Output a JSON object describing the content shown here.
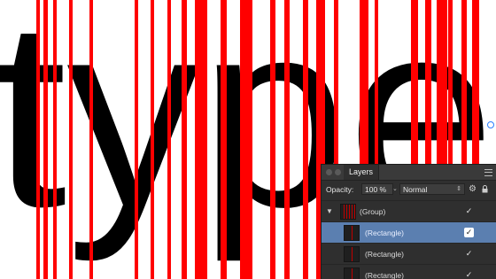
{
  "canvas": {
    "text": "type",
    "text_color": "#000000",
    "stripe_color": "#ff0000"
  },
  "layers_panel": {
    "tab_label": "Layers",
    "opacity_label": "Opacity:",
    "opacity_value": "100 %",
    "blend_mode": "Normal",
    "rows": [
      {
        "name": "(Group)",
        "visible_mark": "✓",
        "selected": false
      },
      {
        "name": "(Rectangle)",
        "visible_mark": "✓",
        "selected": true
      },
      {
        "name": "(Rectangle)",
        "visible_mark": "✓",
        "selected": false
      },
      {
        "name": "(Rectangle)",
        "visible_mark": "✓",
        "selected": false
      }
    ]
  }
}
